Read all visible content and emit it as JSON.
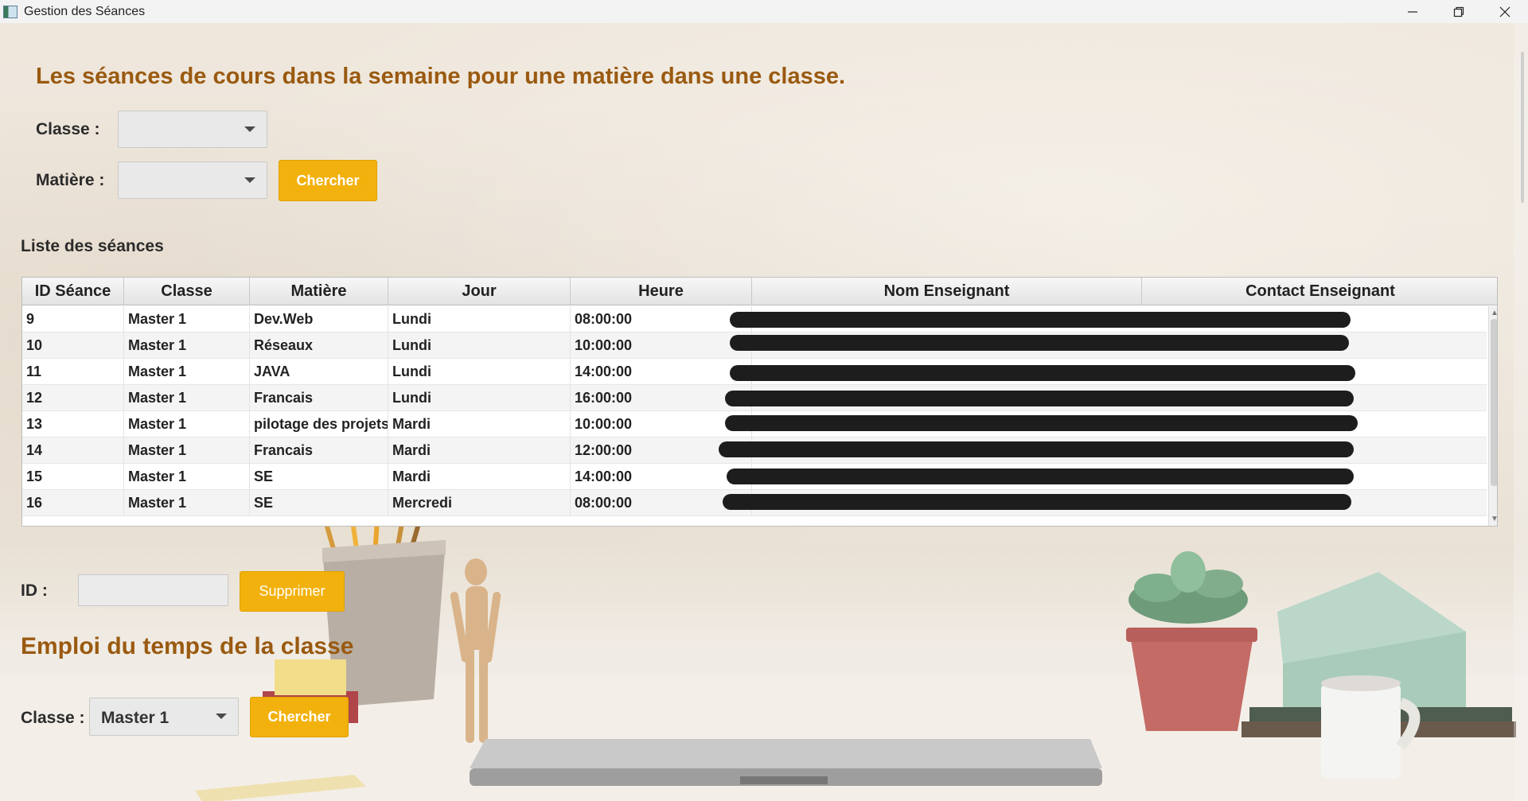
{
  "window": {
    "title": "Gestion des Séances",
    "controls": {
      "minimize": "—",
      "maximize": "❐",
      "close": "✕"
    }
  },
  "search": {
    "heading": "Les séances de cours dans la semaine pour une matière dans une classe.",
    "classe_label": "Classe :",
    "classe_value": "",
    "matiere_label": "Matière :",
    "matiere_value": "",
    "search_button": "Chercher"
  },
  "list": {
    "title": "Liste des séances",
    "columns": [
      "ID Séance",
      "Classe",
      "Matière",
      "Jour",
      "Heure",
      "Nom Enseignant",
      "Contact Enseignant"
    ],
    "rows": [
      [
        "9",
        "Master 1",
        "Dev.Web",
        "Lundi",
        "08:00:00"
      ],
      [
        "10",
        "Master 1",
        "Réseaux",
        "Lundi",
        "10:00:00"
      ],
      [
        "11",
        "Master 1",
        "JAVA",
        "Lundi",
        "14:00:00"
      ],
      [
        "12",
        "Master 1",
        "Francais",
        "Lundi",
        "16:00:00"
      ],
      [
        "13",
        "Master 1",
        "pilotage des projets",
        "Mardi",
        "10:00:00"
      ],
      [
        "14",
        "Master 1",
        "Francais",
        "Mardi",
        "12:00:00"
      ],
      [
        "15",
        "Master 1",
        "SE",
        "Mardi",
        "14:00:00"
      ],
      [
        "16",
        "Master 1",
        "SE",
        "Mercredi",
        "08:00:00"
      ]
    ]
  },
  "delete": {
    "id_label": "ID :",
    "id_value": "",
    "delete_button": "Supprimer"
  },
  "timetable": {
    "heading": "Emploi du temps de la classe",
    "classe_label": "Classe :",
    "classe_value": "Master 1",
    "search_button": "Chercher"
  },
  "colors": {
    "accent": "#f2b10c",
    "heading": "#9a5a10"
  }
}
